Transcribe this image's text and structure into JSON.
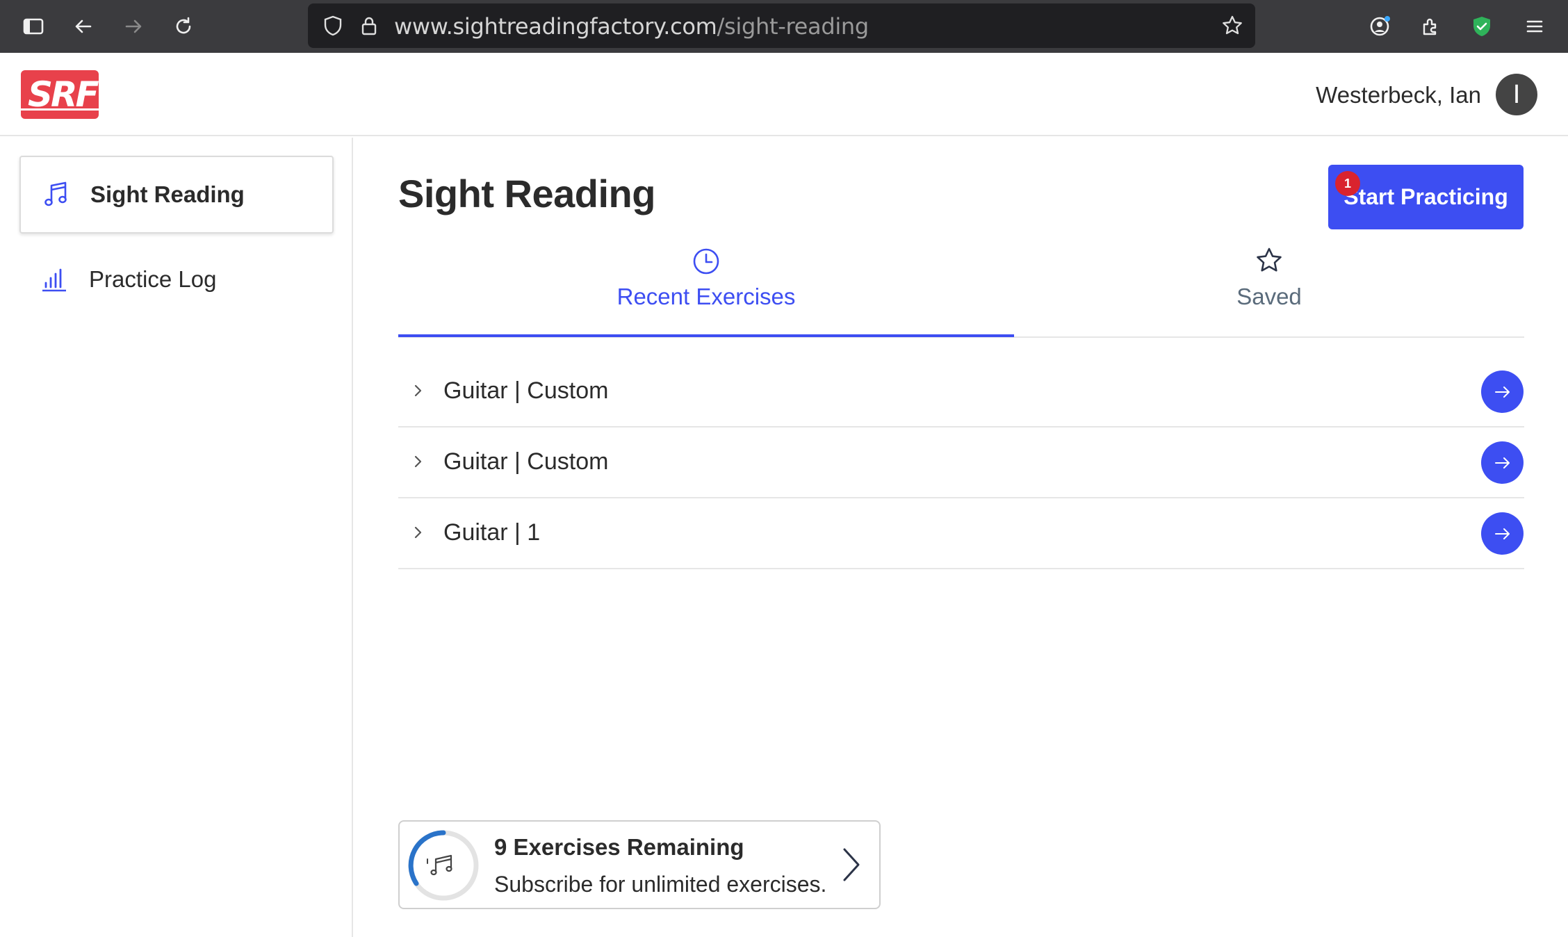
{
  "browser": {
    "url_host": "www.sightreadingfactory.com",
    "url_path": "/sight-reading"
  },
  "header": {
    "logo_text": "SRF",
    "user_name": "Westerbeck, Ian",
    "avatar_initial": "I"
  },
  "sidebar": {
    "items": [
      {
        "label": "Sight Reading",
        "icon": "music-note-icon",
        "active": true
      },
      {
        "label": "Practice Log",
        "icon": "bar-chart-icon",
        "active": false
      }
    ]
  },
  "main": {
    "title": "Sight Reading",
    "start_button": "Start Practicing",
    "notification_count": "1",
    "tabs": [
      {
        "label": "Recent Exercises",
        "icon": "clock-icon",
        "active": true
      },
      {
        "label": "Saved",
        "icon": "star-icon",
        "active": false
      }
    ],
    "exercises": [
      {
        "label": "Guitar | Custom"
      },
      {
        "label": "Guitar | Custom"
      },
      {
        "label": "Guitar | 1"
      }
    ],
    "remaining": {
      "title": "9 Exercises Remaining",
      "subtitle": "Subscribe for unlimited exercises."
    }
  },
  "colors": {
    "accent": "#3d4ef2",
    "brand": "#e8414b",
    "badge": "#d9232e"
  }
}
